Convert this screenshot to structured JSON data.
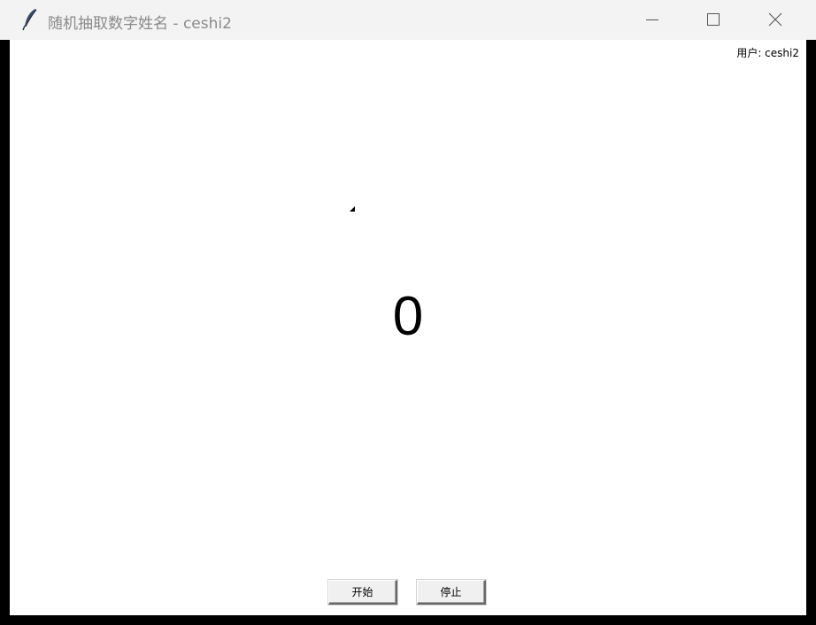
{
  "window": {
    "title": "随机抽取数字姓名 - ceshi2",
    "icon": "feather-icon"
  },
  "header": {
    "user_label": "用户: ceshi2"
  },
  "main": {
    "number": "0"
  },
  "controls": {
    "start_label": "开始",
    "stop_label": "停止"
  },
  "colors": {
    "titlebar_bg": "#f3f3f3",
    "title_text": "#8a8a8a",
    "client_bg": "#ffffff",
    "button_bg": "#f0f0f0"
  }
}
